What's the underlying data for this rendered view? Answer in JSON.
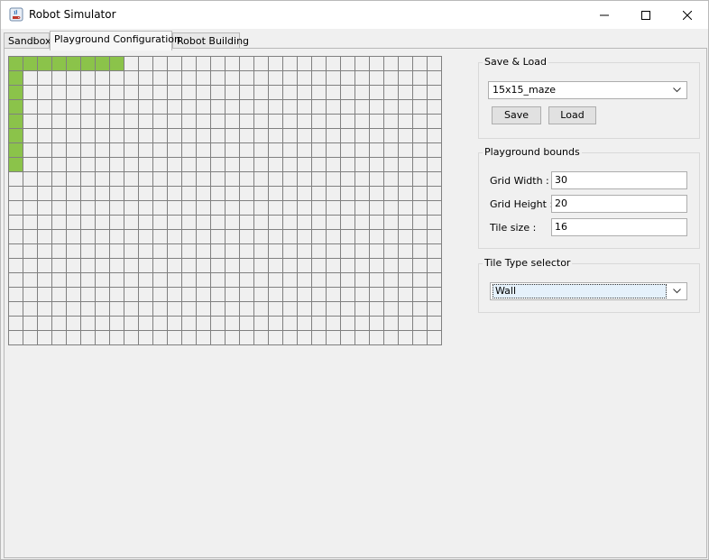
{
  "window": {
    "title": "Robot Simulator",
    "icon": "java-coffee-icon"
  },
  "window_controls": {
    "minimize": "minimize-icon",
    "maximize": "maximize-icon",
    "close": "close-icon"
  },
  "tabs": [
    {
      "label": "Sandbox",
      "active": false
    },
    {
      "label": "Playground Configuration",
      "active": true
    },
    {
      "label": "Robot Building",
      "active": false
    }
  ],
  "save_load": {
    "title": "Save & Load",
    "selected": "15x15_maze",
    "save_label": "Save",
    "load_label": "Load"
  },
  "bounds": {
    "title": "Playground bounds",
    "width_label": "Grid Width :",
    "width_value": "30",
    "height_label": "Grid Height :",
    "height_value": "20",
    "tile_label": "Tile size :",
    "tile_value": "16"
  },
  "tile_type": {
    "title": "Tile Type selector",
    "selected": "Wall"
  },
  "grid": {
    "columns": 30,
    "rows": 20,
    "wall_tiles": [
      [
        0,
        0
      ],
      [
        1,
        0
      ],
      [
        2,
        0
      ],
      [
        3,
        0
      ],
      [
        4,
        0
      ],
      [
        5,
        0
      ],
      [
        6,
        0
      ],
      [
        7,
        0
      ],
      [
        0,
        1
      ],
      [
        0,
        2
      ],
      [
        0,
        3
      ],
      [
        0,
        4
      ],
      [
        0,
        5
      ],
      [
        0,
        6
      ],
      [
        0,
        7
      ]
    ]
  },
  "colors": {
    "wall": "#8bc34a",
    "empty": "#f0f0f0",
    "gridline": "#808080"
  }
}
